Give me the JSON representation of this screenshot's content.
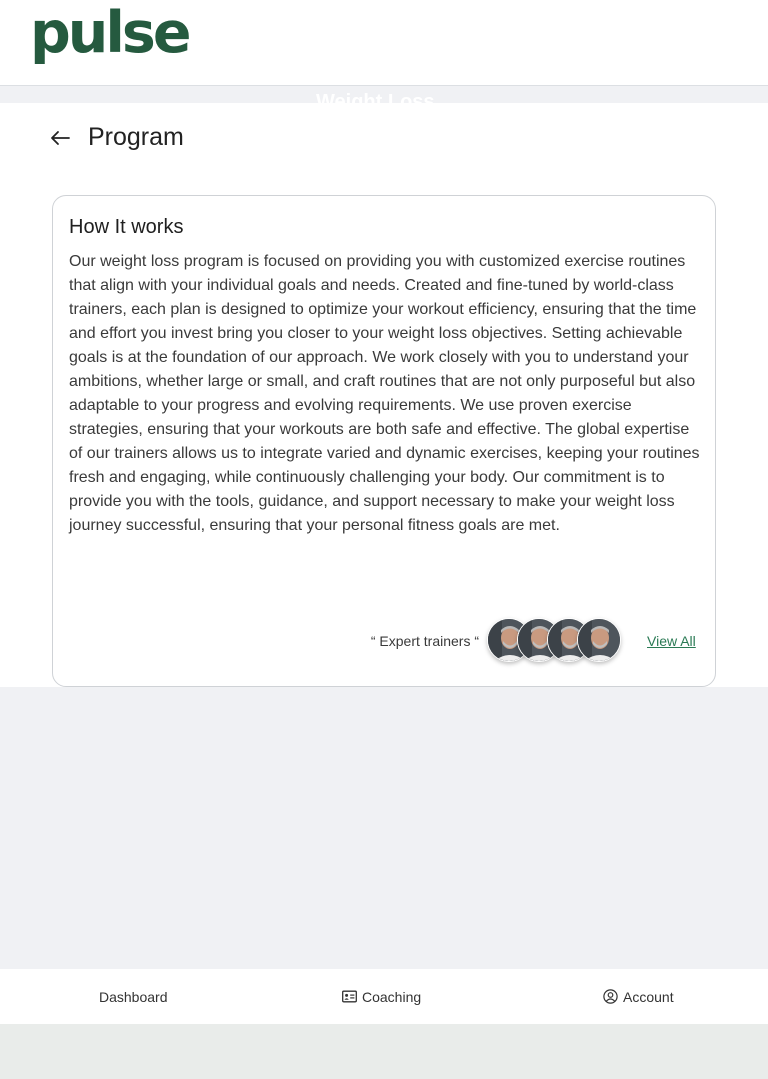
{
  "header": {
    "logo": "pulse",
    "faded_title": "Weight Loss"
  },
  "page": {
    "title": "Program",
    "back_icon": "arrow-left-icon"
  },
  "card": {
    "title": "How It works",
    "body": "Our weight loss program is focused on providing you with customized exercise routines that align with your individual goals and needs. Created and fine-tuned by world-class trainers, each plan is designed to optimize your workout efficiency, ensuring that the time and effort you invest bring you closer to your weight loss objectives. Setting achievable goals is at the foundation of our approach. We work closely with you to understand your ambitions, whether large or small, and craft routines that are not only purposeful but also adaptable to your progress and evolving requirements. We use proven exercise strategies, ensuring that your workouts are both safe and effective. The global expertise of our trainers allows us to integrate varied and dynamic exercises, keeping your routines fresh and engaging, while continuously challenging your body. Our commitment is to provide you with the tools, guidance, and support necessary to make your weight loss journey successful, ensuring that your personal fitness goals are met.",
    "trainers_label": "“ Expert trainers “",
    "view_all_label": "View All",
    "trainer_avatars": [
      "trainer-1",
      "trainer-2",
      "trainer-3",
      "trainer-4"
    ]
  },
  "bottom_nav": {
    "items": [
      {
        "label": "Dashboard",
        "icon": ""
      },
      {
        "label": "Coaching",
        "icon": "id-card-icon"
      },
      {
        "label": "Account",
        "icon": "user-circle-icon"
      }
    ]
  },
  "colors": {
    "brand": "#255a3f",
    "link": "#2a7a54",
    "page_bg": "#f0f1f4",
    "card_border": "#cfd2d6"
  }
}
